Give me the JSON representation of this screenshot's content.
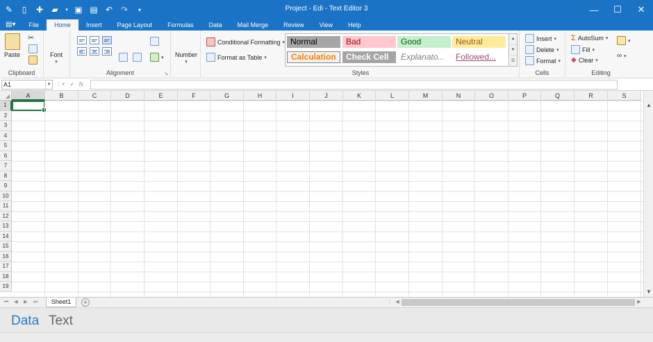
{
  "window": {
    "title": "Project - Edi - Text Editor 3"
  },
  "tabs": [
    {
      "label": "File"
    },
    {
      "label": "Home",
      "active": true
    },
    {
      "label": "Insert"
    },
    {
      "label": "Page Layout"
    },
    {
      "label": "Formulas"
    },
    {
      "label": "Data"
    },
    {
      "label": "Mail Merge"
    },
    {
      "label": "Review"
    },
    {
      "label": "View"
    },
    {
      "label": "Help"
    }
  ],
  "ribbon": {
    "clipboard": {
      "paste": "Paste",
      "label": "Clipboard"
    },
    "font": {
      "button": "Font"
    },
    "alignment": {
      "label": "Alignment"
    },
    "number": {
      "button": "Number"
    },
    "styles_commands": {
      "conditional": "Conditional Formatting",
      "format_table": "Format as Table"
    },
    "styles": {
      "label": "Styles",
      "items": [
        {
          "name": "Normal",
          "bg": "#a6a6a6",
          "fg": "#000000"
        },
        {
          "name": "Bad",
          "bg": "#ffc7ce",
          "fg": "#9c0006"
        },
        {
          "name": "Good",
          "bg": "#c6efce",
          "fg": "#006100"
        },
        {
          "name": "Neutral",
          "bg": "#ffeb9c",
          "fg": "#9c5700"
        },
        {
          "name": "Calculation",
          "bg": "#f2f2f2",
          "fg": "#fa7d00"
        },
        {
          "name": "Check Cell",
          "bg": "#a5a5a5",
          "fg": "#ffffff"
        },
        {
          "name": "Explanato...",
          "bg": "#ffffff",
          "fg": "#7f7f7f"
        },
        {
          "name": "Followed...",
          "bg": "#ffffff",
          "fg": "#954f72"
        }
      ]
    },
    "cells": {
      "insert": "Insert",
      "delete": "Delete",
      "format": "Format",
      "label": "Cells"
    },
    "editing": {
      "autosum": "AutoSum",
      "fill": "Fill",
      "clear": "Clear",
      "label": "Editing"
    }
  },
  "formula_bar": {
    "name_box": "A1",
    "cancel": "×",
    "enter": "✓",
    "fx": "fx",
    "value": ""
  },
  "grid": {
    "columns": [
      "A",
      "B",
      "C",
      "D",
      "E",
      "F",
      "G",
      "H",
      "I",
      "J",
      "K",
      "L",
      "M",
      "N",
      "O",
      "P",
      "Q",
      "R",
      "S"
    ],
    "rows": [
      "1",
      "2",
      "3",
      "4",
      "5",
      "6",
      "7",
      "8",
      "9",
      "10",
      "11",
      "12",
      "13",
      "14",
      "15",
      "16",
      "17",
      "18",
      "19"
    ],
    "active_cell": "A1"
  },
  "sheets": [
    {
      "name": "Sheet1",
      "active": true
    }
  ],
  "views": [
    {
      "label": "Data",
      "active": true
    },
    {
      "label": "Text",
      "active": false
    }
  ]
}
